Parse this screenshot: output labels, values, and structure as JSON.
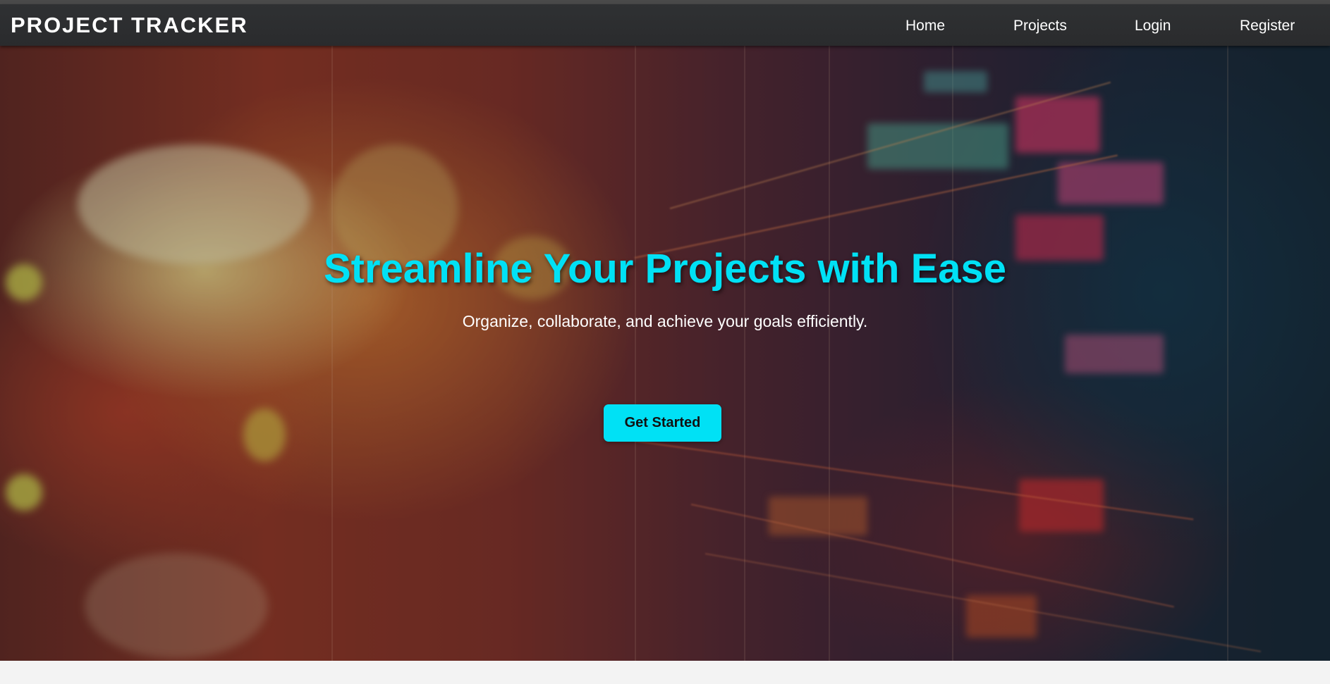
{
  "navbar": {
    "brand": "PROJECT TRACKER",
    "links": [
      {
        "label": "Home"
      },
      {
        "label": "Projects"
      },
      {
        "label": "Login"
      },
      {
        "label": "Register"
      }
    ]
  },
  "hero": {
    "title": "Streamline Your Projects with Ease",
    "subtitle": "Organize, collaborate, and achieve your goals efficiently.",
    "cta_label": "Get Started"
  },
  "colors": {
    "accent": "#00e1f5",
    "navbar": "#2f3133",
    "page_background": "#f3f3f3"
  }
}
